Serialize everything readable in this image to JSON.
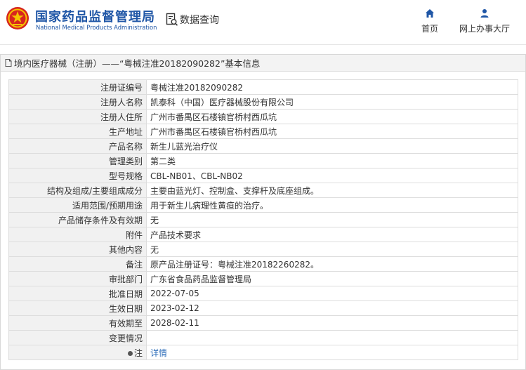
{
  "header": {
    "brand_cn": "国家药品监督管理局",
    "brand_en": "National Medical Products Administration",
    "tool_label": "数据查询",
    "nav": [
      {
        "label": "首页",
        "icon": "home-icon"
      },
      {
        "label": "网上办事大厅",
        "icon": "user-icon"
      }
    ]
  },
  "colors": {
    "brand": "#1f56a6",
    "link": "#2a6bb8",
    "key_bg": "#f1f1f1"
  },
  "page": {
    "title": "境内医疗器械（注册）——“粤械注准20182090282”基本信息"
  },
  "rows": [
    {
      "key": "注册证编号",
      "value": "粤械注准20182090282"
    },
    {
      "key": "注册人名称",
      "value": "凯泰科（中国）医疗器械股份有限公司"
    },
    {
      "key": "注册人住所",
      "value": "广州市番禺区石楼镇官桥村西瓜坑"
    },
    {
      "key": "生产地址",
      "value": "广州市番禺区石楼镇官桥村西瓜坑"
    },
    {
      "key": "产品名称",
      "value": "新生儿蓝光治疗仪"
    },
    {
      "key": "管理类别",
      "value": "第二类"
    },
    {
      "key": "型号规格",
      "value": "CBL-NB01、CBL-NB02"
    },
    {
      "key": "结构及组成/主要组成成分",
      "value": "主要由蓝光灯、控制盒、支撑杆及底座组成。"
    },
    {
      "key": "适用范围/预期用途",
      "value": "用于新生儿病理性黄疸的治疗。"
    },
    {
      "key": "产品储存条件及有效期",
      "value": "无"
    },
    {
      "key": "附件",
      "value": "产品技术要求"
    },
    {
      "key": "其他内容",
      "value": "无"
    },
    {
      "key": "备注",
      "value": "原产品注册证号：粤械注准20182260282。"
    },
    {
      "key": "审批部门",
      "value": "广东省食品药品监督管理局"
    },
    {
      "key": "批准日期",
      "value": "2022-07-05"
    },
    {
      "key": "生效日期",
      "value": "2023-02-12"
    },
    {
      "key": "有效期至",
      "value": "2028-02-11"
    },
    {
      "key": "变更情况",
      "value": ""
    }
  ],
  "note_row": {
    "key": "注",
    "link_label": "详情",
    "icon": "pin-icon"
  }
}
